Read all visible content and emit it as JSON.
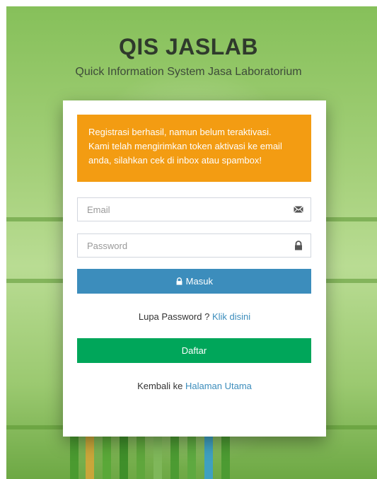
{
  "header": {
    "title": "QIS JASLAB",
    "subtitle": "Quick Information System Jasa Laboratorium"
  },
  "alert": {
    "lines": [
      "Registrasi berhasil, namun belum teraktivasi.",
      "Kami telah mengirimkan token aktivasi ke email",
      "anda, silahkan cek di inbox atau spambox!"
    ],
    "color": "#f39c12"
  },
  "form": {
    "email_placeholder": "Email",
    "email_icon": "envelope-icon",
    "password_placeholder": "Password",
    "password_icon": "lock-icon",
    "login_label": "Masuk",
    "login_color": "#3c8dbc"
  },
  "forgot": {
    "text": "Lupa Password ? ",
    "link": "Klik disini"
  },
  "register": {
    "label": "Daftar",
    "color": "#00a65a"
  },
  "back": {
    "text": "Kembali ke ",
    "link": "Halaman Utama"
  },
  "colors": {
    "link": "#3c8dbc"
  }
}
